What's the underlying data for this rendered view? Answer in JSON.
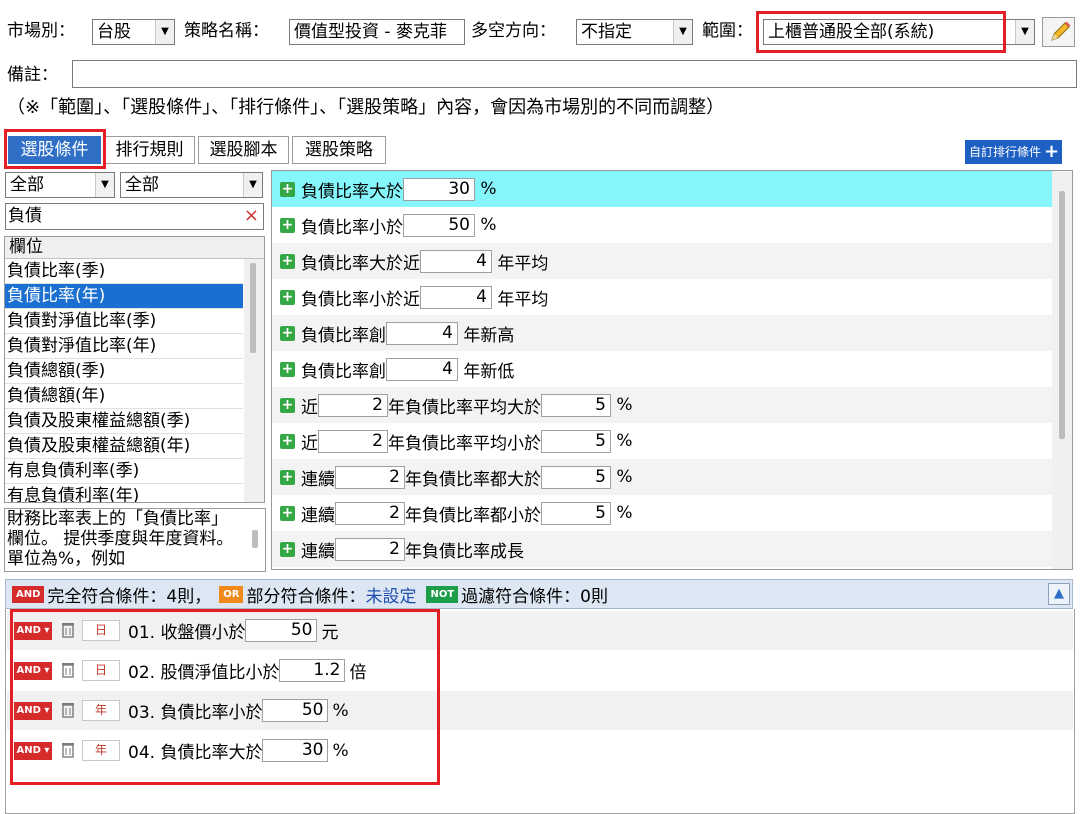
{
  "top": {
    "market_label": "市場別：",
    "market_value": "台股",
    "strategy_label": "策略名稱：",
    "strategy_value": "價值型投資 - 麥克菲",
    "direction_label": "多空方向：",
    "direction_value": "不指定",
    "range_label": "範圍：",
    "range_value": "上櫃普通股全部(系統)",
    "remark_label": "備註：",
    "note": "（※「範圍」、「選股條件」、「排行條件」、「選股策略」內容，會因為市場別的不同而調整）"
  },
  "tabs": [
    "選股條件",
    "排行規則",
    "選股腳本",
    "選股策略"
  ],
  "custom_rank_button": "自訂排行條件",
  "filters": {
    "category1": "全部",
    "category2": "全部",
    "search_value": "負債"
  },
  "field_list": {
    "header": "欄位",
    "items": [
      "負債比率(季)",
      "負債比率(年)",
      "負債對淨值比率(季)",
      "負債對淨值比率(年)",
      "負債總額(季)",
      "負債總額(年)",
      "負債及股東權益總額(季)",
      "負債及股東權益總額(年)",
      "有息負債利率(季)",
      "有息負債利率(年)"
    ],
    "selected_index": 1
  },
  "description": "財務比率表上的「負債比率」欄位。 提供季度與年度資料。 單位為%，例如",
  "conditions": [
    {
      "parts": [
        {
          "t": "負債比率大於"
        },
        {
          "v": "30",
          "w": 72
        },
        {
          "t": " %"
        }
      ]
    },
    {
      "parts": [
        {
          "t": "負債比率小於"
        },
        {
          "v": "50",
          "w": 72
        },
        {
          "t": " %"
        }
      ]
    },
    {
      "parts": [
        {
          "t": "負債比率大於近"
        },
        {
          "v": "4",
          "w": 72
        },
        {
          "t": " 年平均"
        }
      ]
    },
    {
      "parts": [
        {
          "t": "負債比率小於近"
        },
        {
          "v": "4",
          "w": 72
        },
        {
          "t": " 年平均"
        }
      ]
    },
    {
      "parts": [
        {
          "t": "負債比率創"
        },
        {
          "v": "4",
          "w": 72
        },
        {
          "t": " 年新高"
        }
      ]
    },
    {
      "parts": [
        {
          "t": "負債比率創"
        },
        {
          "v": "4",
          "w": 72
        },
        {
          "t": " 年新低"
        }
      ]
    },
    {
      "parts": [
        {
          "t": "近"
        },
        {
          "v": "2",
          "w": 70
        },
        {
          "t": "年負債比率平均大於"
        },
        {
          "v": "5",
          "w": 70
        },
        {
          "t": " %"
        }
      ]
    },
    {
      "parts": [
        {
          "t": "近"
        },
        {
          "v": "2",
          "w": 70
        },
        {
          "t": "年負債比率平均小於"
        },
        {
          "v": "5",
          "w": 70
        },
        {
          "t": " %"
        }
      ]
    },
    {
      "parts": [
        {
          "t": "連續"
        },
        {
          "v": "2",
          "w": 70
        },
        {
          "t": "年負債比率都大於"
        },
        {
          "v": "5",
          "w": 70
        },
        {
          "t": " %"
        }
      ]
    },
    {
      "parts": [
        {
          "t": "連續"
        },
        {
          "v": "2",
          "w": 70
        },
        {
          "t": "年負債比率都小於"
        },
        {
          "v": "5",
          "w": 70
        },
        {
          "t": " %"
        }
      ]
    },
    {
      "parts": [
        {
          "t": "連續"
        },
        {
          "v": "2",
          "w": 70
        },
        {
          "t": "年負債比率成長"
        }
      ]
    }
  ],
  "summary": {
    "and_tag": "AND",
    "full_label": "完全符合條件：4則，",
    "or_tag": "OR",
    "partial_label": "部分符合條件：",
    "partial_value": "未設定",
    "not_tag": "NOT",
    "filter_label": "過濾符合條件：0則"
  },
  "selected_conditions": [
    {
      "and": "AND",
      "period": "日",
      "text": "01. 收盤價小於",
      "value": "50",
      "unit": "元"
    },
    {
      "and": "AND",
      "period": "日",
      "text": "02. 股價淨值比小於",
      "value": "1.2",
      "unit": "倍"
    },
    {
      "and": "AND",
      "period": "年",
      "text": "03. 負債比率小於",
      "value": "50",
      "unit": "%"
    },
    {
      "and": "AND",
      "period": "年",
      "text": "04. 負債比率大於",
      "value": "30",
      "unit": "%"
    }
  ],
  "colors": {
    "accent": "#2f6fc6",
    "highlight": "#85f6fb",
    "red": "#e31e24",
    "green": "#35a845",
    "and": "#d62b2b",
    "or": "#f28a1b",
    "not": "#1d9c4a"
  }
}
